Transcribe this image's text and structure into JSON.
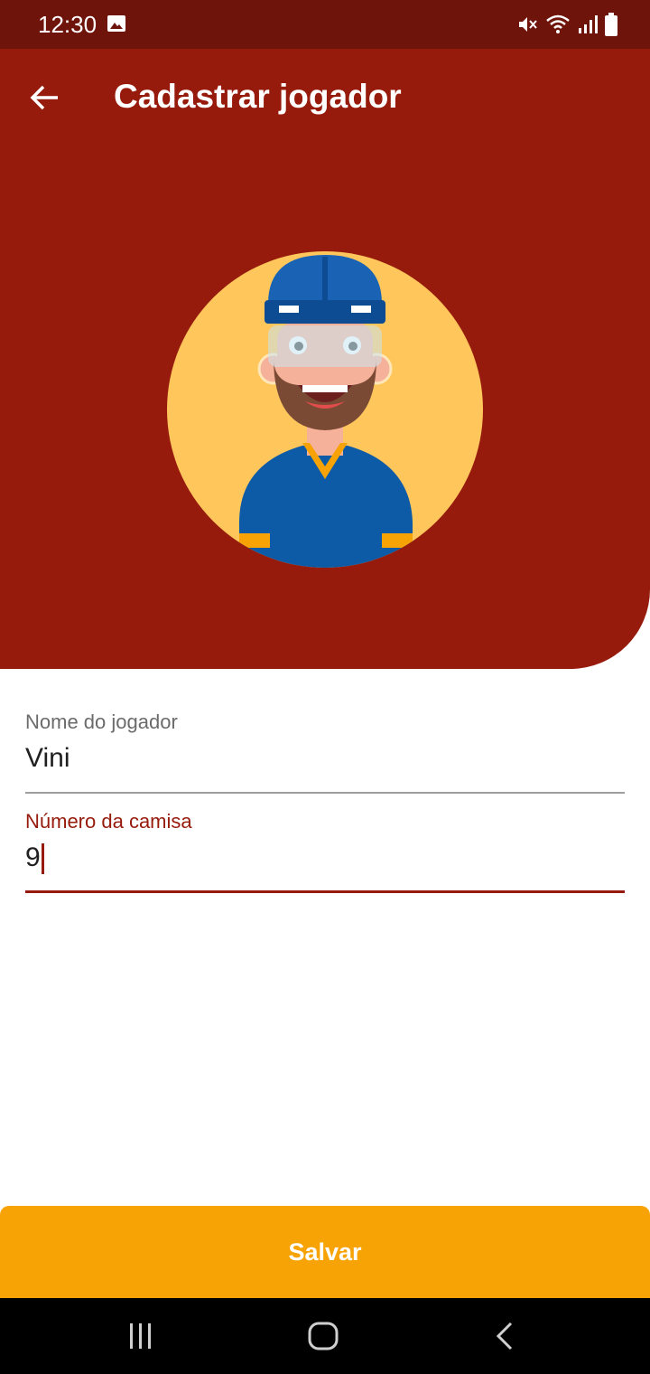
{
  "status_bar": {
    "time": "12:30",
    "icons": [
      "image-icon",
      "mute-icon",
      "wifi-icon",
      "signal-icon",
      "battery-icon"
    ]
  },
  "header": {
    "title": "Cadastrar jogador",
    "back_icon": "arrow-left-icon",
    "avatar_icon": "player-avatar"
  },
  "form": {
    "name_field": {
      "label": "Nome do jogador",
      "value": "Vini"
    },
    "number_field": {
      "label": "Número da camisa",
      "value": "9"
    }
  },
  "save_label": "Salvar",
  "nav_bar": {
    "icons": [
      "recent-apps-icon",
      "home-icon",
      "back-icon"
    ]
  },
  "colors": {
    "status_bar": "#6e140b",
    "primary": "#961b0c",
    "accent": "#f7a306",
    "avatar_bg": "#ffc65c"
  }
}
